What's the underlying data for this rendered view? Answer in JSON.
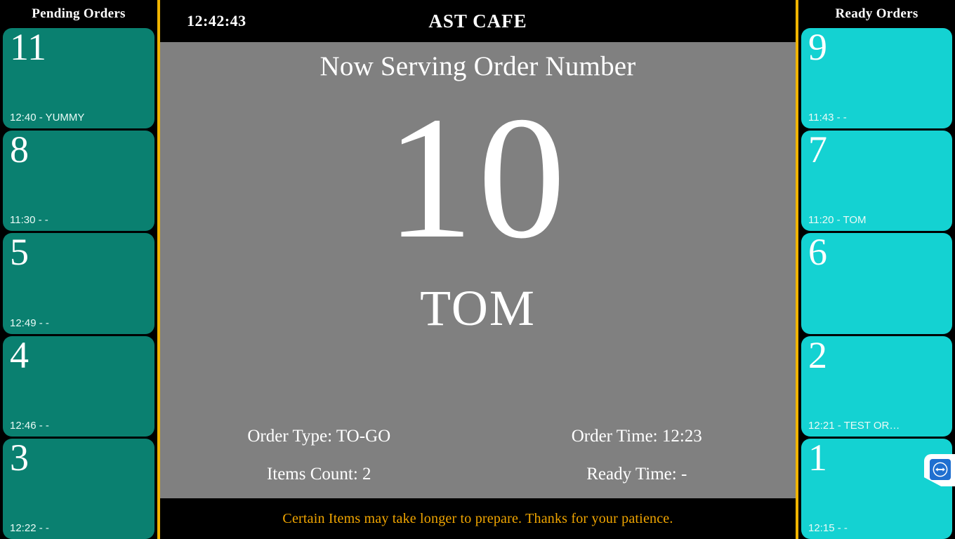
{
  "header": {
    "clock": "12:42:43",
    "store_name": "AST CAFE"
  },
  "pending_panel": {
    "title": "Pending Orders",
    "color": "#0a8070",
    "orders": [
      {
        "number": "11",
        "meta": "12:40 - YUMMY"
      },
      {
        "number": "8",
        "meta": "11:30 - -"
      },
      {
        "number": "5",
        "meta": "12:49 - -"
      },
      {
        "number": "4",
        "meta": "12:46 - -"
      },
      {
        "number": "3",
        "meta": "12:22 - -"
      }
    ]
  },
  "ready_panel": {
    "title": "Ready Orders",
    "color": "#14d2d2",
    "orders": [
      {
        "number": "9",
        "meta": "11:43 - -"
      },
      {
        "number": "7",
        "meta": "11:20 - TOM"
      },
      {
        "number": "6",
        "meta": ""
      },
      {
        "number": "2",
        "meta": "12:21 - TEST OR…"
      },
      {
        "number": "1",
        "meta": "12:15 - -"
      }
    ]
  },
  "now_serving": {
    "heading": "Now Serving Order Number",
    "order_number": "10",
    "customer_name": "TOM",
    "order_type_label": "Order Type: TO-GO",
    "order_time_label": "Order Time: 12:23",
    "items_count_label": "Items Count: 2",
    "ready_time_label": "Ready Time: -"
  },
  "ticker": {
    "message": "Certain Items may take longer to prepare. Thanks for your patience."
  },
  "accent": {
    "divider": "#f0b400",
    "ticker_text": "#f0a500",
    "stage_bg": "#808080"
  },
  "overlay": {
    "teamviewer_icon": "teamviewer-icon"
  }
}
